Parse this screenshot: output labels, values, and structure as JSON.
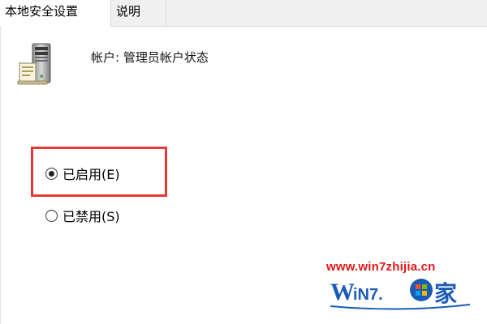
{
  "tabs": [
    {
      "label": "本地安全设置"
    },
    {
      "label": "说明"
    }
  ],
  "policy": {
    "title": "帐户: 管理员帐户状态",
    "icon": "server-policy-icon"
  },
  "options": [
    {
      "label": "已启用(E)",
      "selected": true
    },
    {
      "label": "已禁用(S)",
      "selected": false
    }
  ],
  "annotation": {
    "color": "#e53935"
  },
  "watermark": {
    "url": "www.win7zhijia.cn",
    "logo_text": "WiN7.系统之家",
    "colors": {
      "url": "#e01818",
      "logo": "#1b5bb7"
    }
  }
}
